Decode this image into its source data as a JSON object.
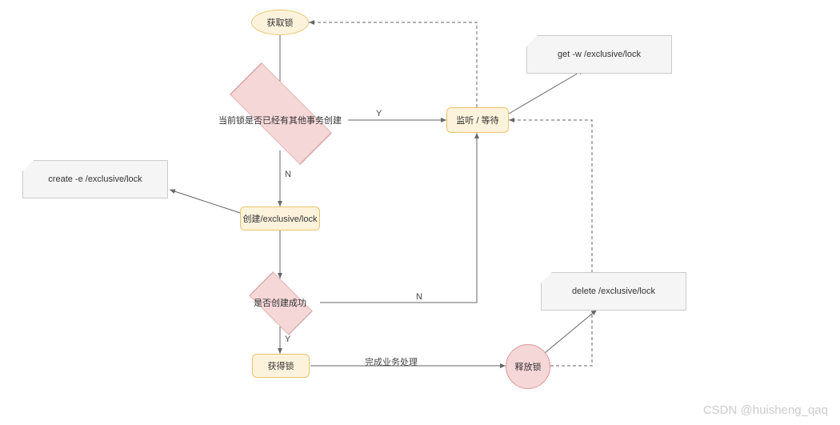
{
  "chart_data": {
    "type": "flowchart",
    "nodes": {
      "start": {
        "shape": "ellipse",
        "label": "获取锁"
      },
      "check_exists": {
        "shape": "diamond",
        "label": "当前锁是否已经有其他事务创建"
      },
      "listen": {
        "shape": "rect",
        "label": "监听 / 等待"
      },
      "create": {
        "shape": "rect",
        "label": "创建/exclusive/lock"
      },
      "check_ok": {
        "shape": "diamond",
        "label": "是否创建成功"
      },
      "got": {
        "shape": "rect",
        "label": "获得锁"
      },
      "release": {
        "shape": "circle",
        "label": "释放锁"
      }
    },
    "notes": {
      "note_create": "create  -e  /exclusive/lock",
      "note_get": "get  -w  /exclusive/lock",
      "note_delete": "delete   /exclusive/lock"
    },
    "edges": [
      {
        "from": "start",
        "to": "check_exists"
      },
      {
        "from": "check_exists",
        "to": "listen",
        "label": "Y"
      },
      {
        "from": "check_exists",
        "to": "create",
        "label": "N"
      },
      {
        "from": "create",
        "to": "check_ok"
      },
      {
        "from": "check_ok",
        "to": "listen",
        "label": "N"
      },
      {
        "from": "check_ok",
        "to": "got",
        "label": "Y"
      },
      {
        "from": "got",
        "to": "release",
        "label": "完成业务处理"
      },
      {
        "from": "release",
        "to": "listen",
        "style": "dashed"
      },
      {
        "from": "listen",
        "to": "start",
        "style": "dashed"
      },
      {
        "from": "create",
        "to": "note_create",
        "style": "arrow"
      },
      {
        "from": "listen",
        "to": "note_get",
        "style": "arrow"
      },
      {
        "from": "release",
        "to": "note_delete",
        "style": "arrow"
      }
    ],
    "edge_labels": {
      "y": "Y",
      "n": "N",
      "done": "完成业务处理"
    }
  },
  "watermark": "CSDN @huisheng_qaq"
}
